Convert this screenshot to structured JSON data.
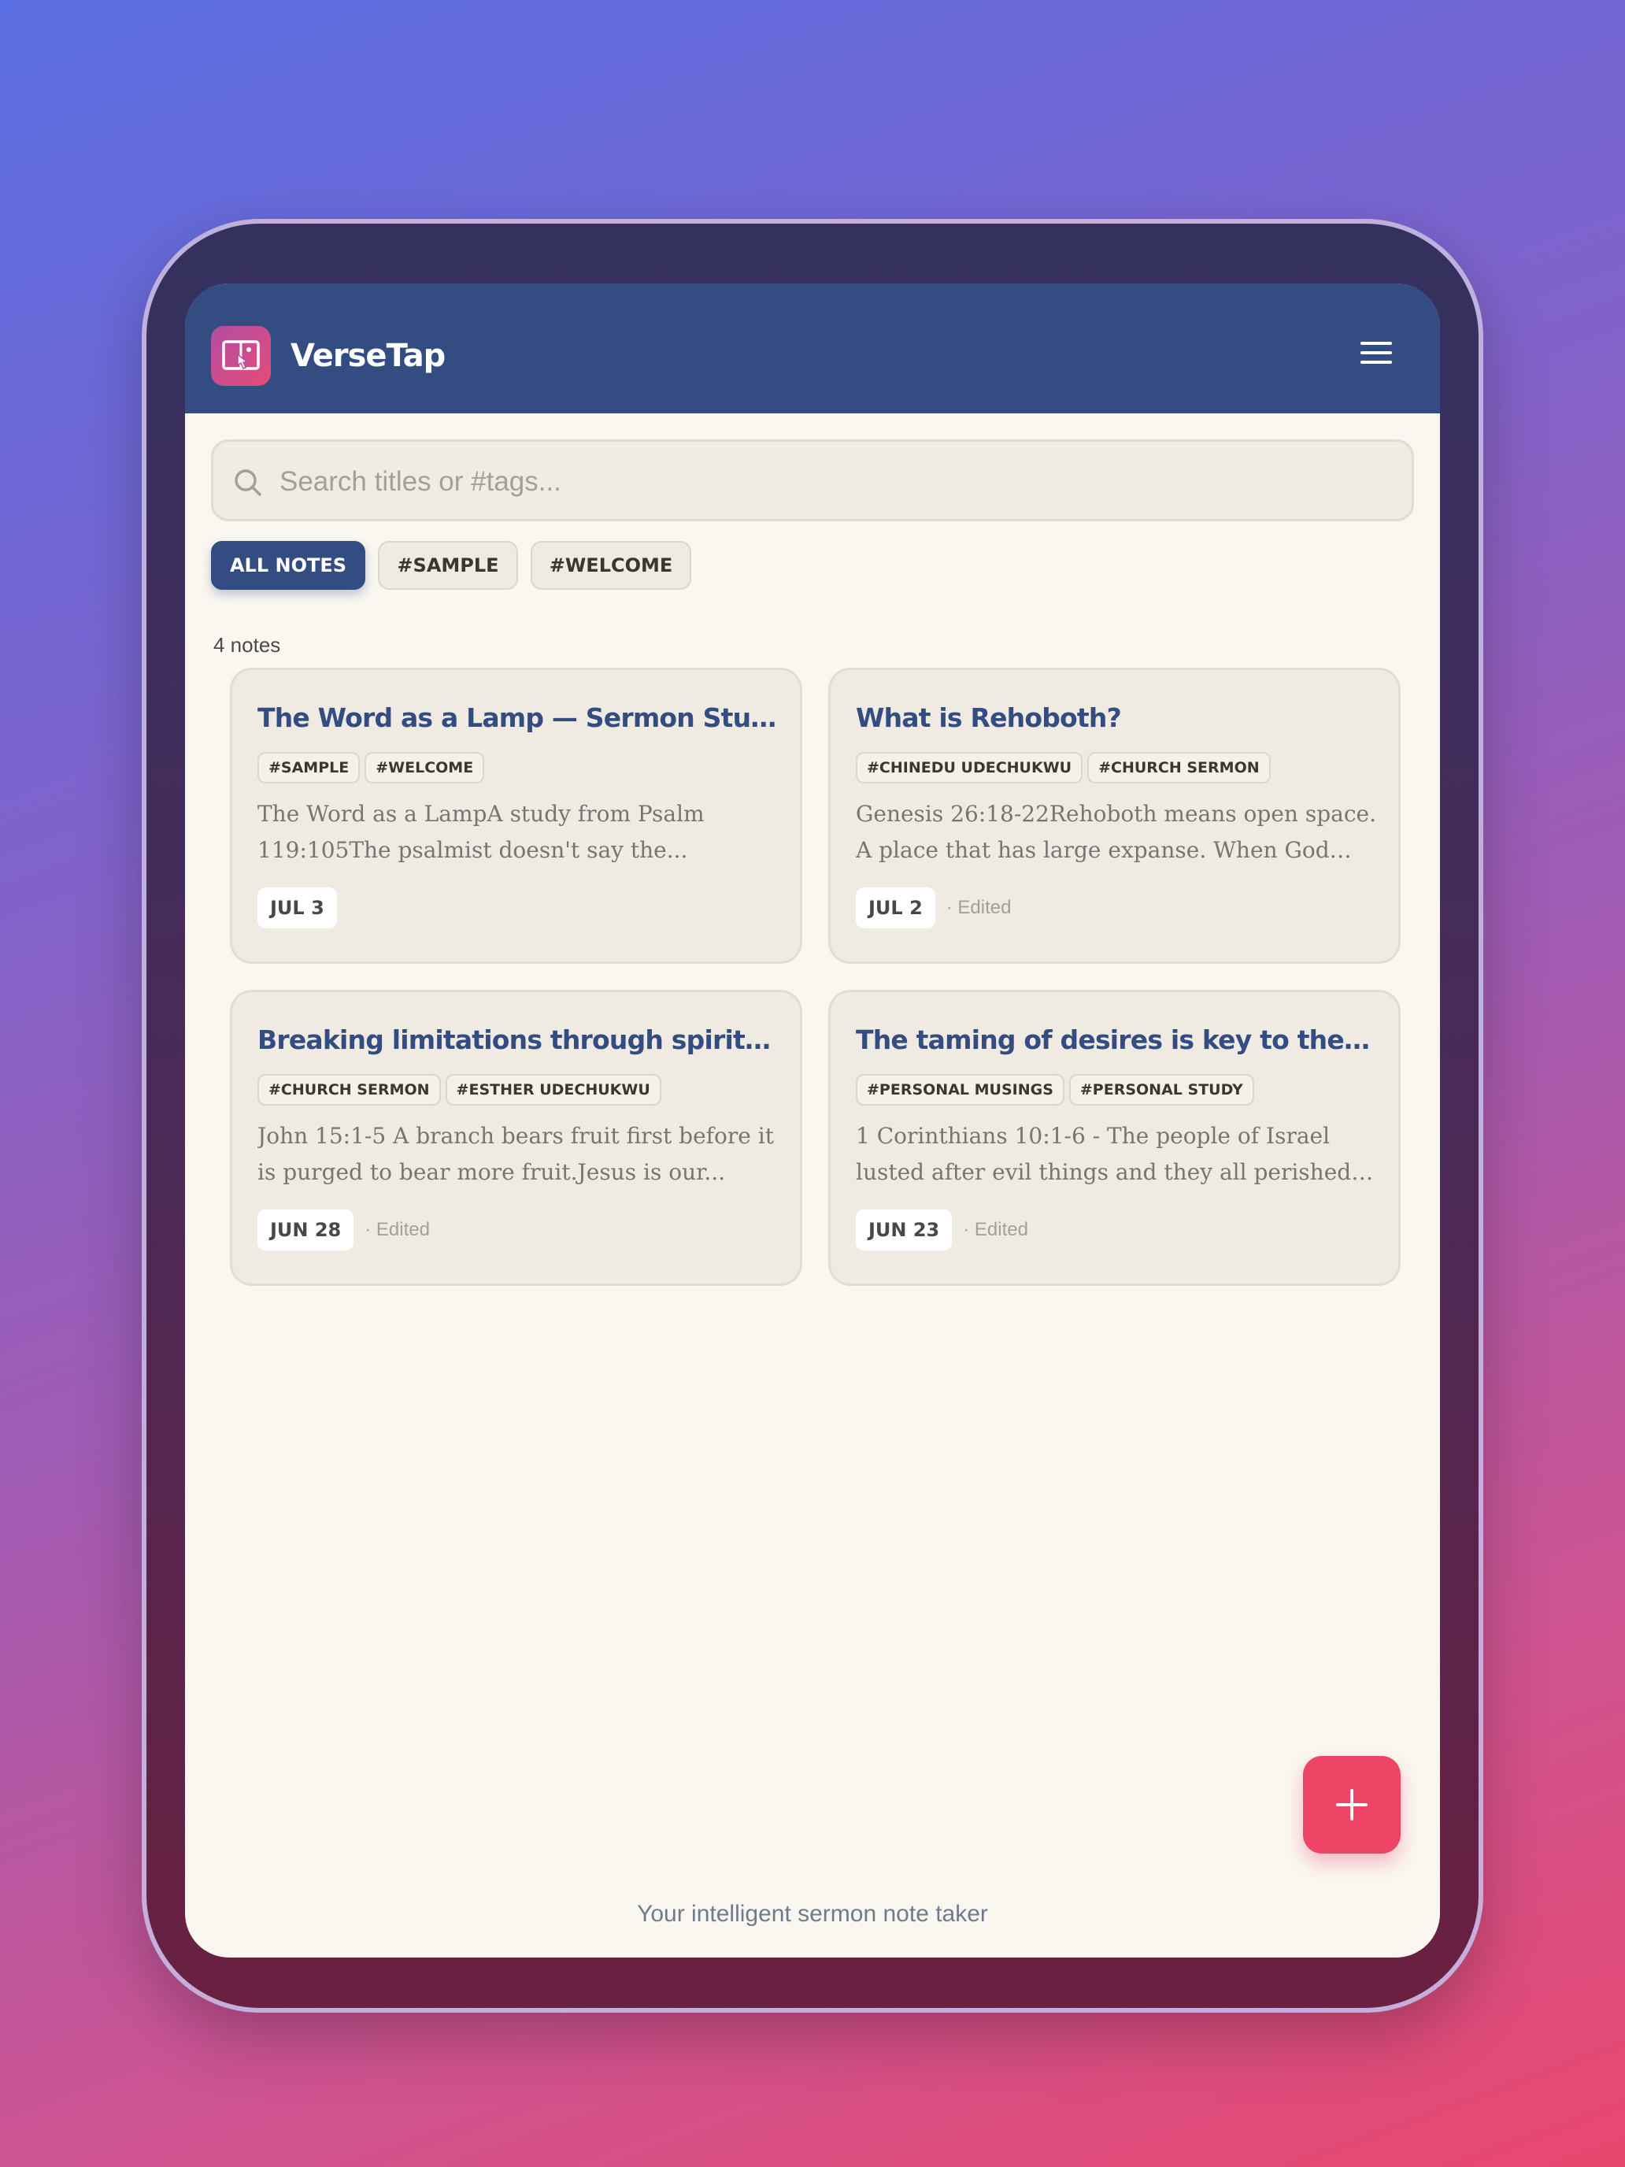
{
  "app": {
    "title": "VerseTap",
    "logo_icon": "touch-book-icon",
    "menu_icon": "hamburger-menu-icon"
  },
  "search": {
    "placeholder": "Search titles or #tags...",
    "value": ""
  },
  "filters": [
    {
      "label": "ALL NOTES",
      "active": true
    },
    {
      "label": "#SAMPLE",
      "active": false
    },
    {
      "label": "#WELCOME",
      "active": false
    }
  ],
  "notes_count": "4 notes",
  "notes": [
    {
      "title": "The Word as a Lamp — Sermon Study",
      "tags": [
        "#SAMPLE",
        "#WELCOME"
      ],
      "excerpt": "The Word as a LampA study from Psalm 119:105The psalmist doesn't say the...",
      "date": "JUL 3",
      "edited": ""
    },
    {
      "title": "What is Rehoboth?",
      "tags": [
        "#CHINEDU UDECHUKWU",
        "#CHURCH SERMON"
      ],
      "excerpt": "Genesis 26:18-22Rehoboth means open space. A place that has large expanse. When God gives...",
      "date": "JUL 2",
      "edited": "· Edited"
    },
    {
      "title": "Breaking limitations through spiritual ...",
      "tags": [
        "#CHURCH SERMON",
        "#ESTHER UDECHUKWU"
      ],
      "excerpt": "John 15:1-5 A branch bears fruit first before it is purged to bear more fruit.Jesus is our...",
      "date": "JUN 28",
      "edited": "· Edited"
    },
    {
      "title": "The taming of desires is key to the beli...",
      "tags": [
        "#PERSONAL MUSINGS",
        "#PERSONAL STUDY"
      ],
      "excerpt": "1 Corinthians 10:1-6 - The people of Israel lusted after evil things and they all perished despit...",
      "date": "JUN 23",
      "edited": "· Edited"
    }
  ],
  "fab_icon": "plus-icon",
  "footer": {
    "tagline": "Your intelligent sermon note taker"
  },
  "colors": {
    "header": "#334c82",
    "accent": "#ee4466",
    "background": "#faf7f1",
    "card": "#efebe3"
  }
}
